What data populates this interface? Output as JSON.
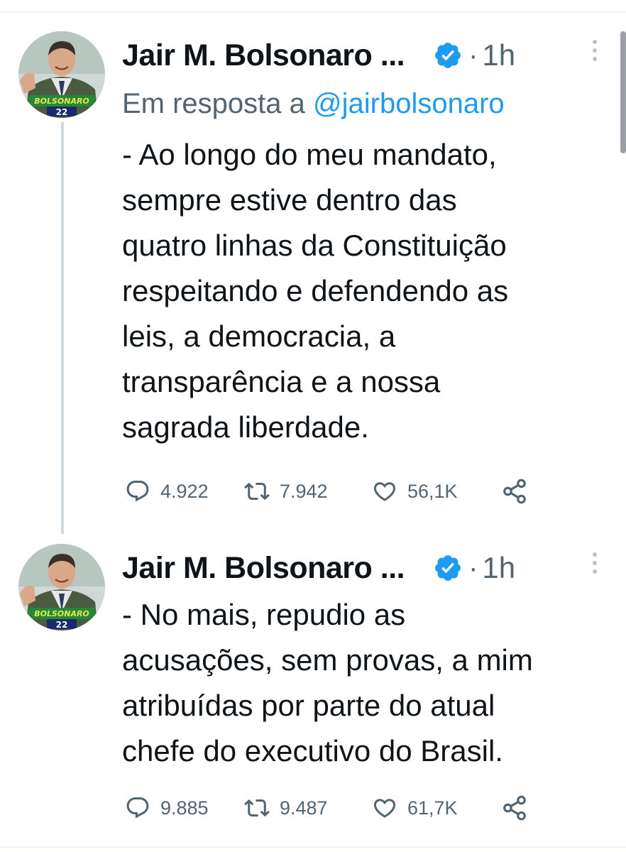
{
  "tweets": [
    {
      "author": "Jair M. Bolsonaro ...",
      "separator": "·",
      "time": "1h",
      "reply_prefix": "Em resposta a ",
      "reply_handle": "@jairbolsonaro",
      "text": "- Ao longo do meu mandato,\nsempre estive dentro das\nquatro linhas da Constituição\nrespeitando e defendendo as\nleis, a democracia, a\ntransparência e a nossa\nsagrada liberdade.",
      "replies": "4.922",
      "retweets": "7.942",
      "likes": "56,1K",
      "avatar_badge": "BOLSONARO",
      "avatar_number": "22"
    },
    {
      "author": "Jair M. Bolsonaro ...",
      "separator": "·",
      "time": "1h",
      "text": "- No mais, repudio as\nacusações, sem provas, a mim\natribuídas por parte do atual\nchefe do executivo do Brasil.",
      "replies": "9.885",
      "retweets": "9.487",
      "likes": "61,7K",
      "avatar_badge": "BOLSONARO",
      "avatar_number": "22"
    }
  ],
  "icons": {
    "verified": "verified-badge-icon",
    "more": "more-vertical-icon",
    "reply": "reply-icon",
    "retweet": "retweet-icon",
    "like": "like-heart-icon",
    "share": "share-icon"
  },
  "colors": {
    "accent": "#1d9bf0",
    "text": "#0f1419",
    "muted": "#536471",
    "thread_line": "#cfd9de"
  }
}
